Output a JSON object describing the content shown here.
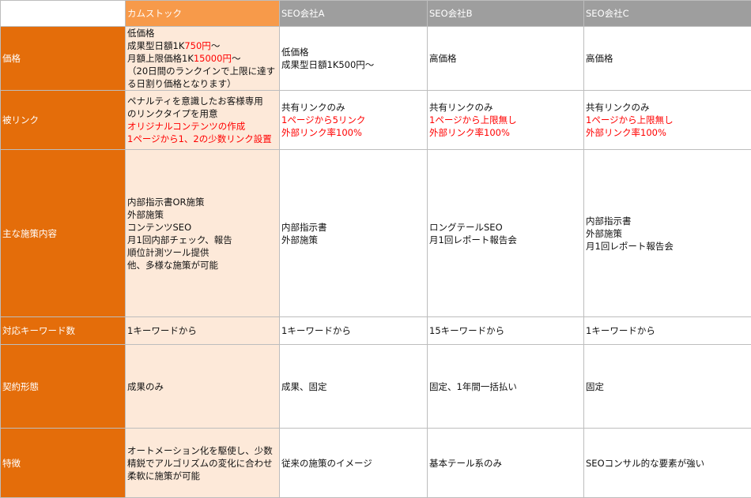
{
  "colors": {
    "header_gray": "#9e9e9e",
    "header_orange": "#f79a4a",
    "row_label": "#e46d0a",
    "highlight_column": "#fde9d9",
    "emphasis_text": "#ff0000"
  },
  "headers": [
    "",
    "カムストック",
    "SEO会社A",
    "SEO会社B",
    "SEO会社C"
  ],
  "rows": [
    {
      "label": "価格",
      "cells": [
        [
          [
            {
              "t": "低価格"
            }
          ],
          [
            {
              "t": "成果型日額1K"
            },
            {
              "t": "750円",
              "red": true
            },
            {
              "t": "～"
            }
          ],
          [
            {
              "t": "月額上限価格1K"
            },
            {
              "t": "15000円",
              "red": true
            },
            {
              "t": "～"
            }
          ],
          [
            {
              "t": "（20日間のランクインで上限に達する日割り価格となります）",
              "wrap": true
            }
          ]
        ],
        [
          [
            {
              "t": "低価格"
            }
          ],
          [
            {
              "t": "成果型日額1K500円～"
            }
          ]
        ],
        [
          [
            {
              "t": "高価格"
            }
          ]
        ],
        [
          [
            {
              "t": "高価格"
            }
          ]
        ]
      ]
    },
    {
      "label": "被リンク",
      "cells": [
        [
          [
            {
              "t": "ペナルティを意識したお客様専用"
            }
          ],
          [
            {
              "t": "のリンクタイプを用意"
            }
          ],
          [
            {
              "t": "オリジナルコンテンツの作成",
              "red": true
            }
          ],
          [
            {
              "t": "1ページから1、2の少数リンク設置",
              "red": true
            }
          ]
        ],
        [
          [
            {
              "t": "共有リンクのみ"
            }
          ],
          [
            {
              "t": "1ページから5リンク",
              "red": true
            }
          ],
          [
            {
              "t": "外部リンク率100%",
              "red": true
            }
          ]
        ],
        [
          [
            {
              "t": "共有リンクのみ"
            }
          ],
          [
            {
              "t": "1ページから上限無し",
              "red": true
            }
          ],
          [
            {
              "t": "外部リンク率100%",
              "red": true
            }
          ]
        ],
        [
          [
            {
              "t": "共有リンクのみ"
            }
          ],
          [
            {
              "t": "1ページから上限無し",
              "red": true
            }
          ],
          [
            {
              "t": "外部リンク率100%",
              "red": true
            }
          ]
        ]
      ]
    },
    {
      "label": "主な施策内容",
      "cells": [
        [
          [
            {
              "t": "内部指示書OR施策"
            }
          ],
          [
            {
              "t": "外部施策"
            }
          ],
          [
            {
              "t": "コンテンツSEO"
            }
          ],
          [
            {
              "t": "月1回内部チェック、報告"
            }
          ],
          [
            {
              "t": "順位計測ツール提供"
            }
          ],
          [
            {
              "t": "他、多様な施策が可能"
            }
          ]
        ],
        [
          [
            {
              "t": "内部指示書"
            }
          ],
          [
            {
              "t": "外部施策"
            }
          ]
        ],
        [
          [
            {
              "t": "ロングテールSEO"
            }
          ],
          [
            {
              "t": "月1回レポート報告会"
            }
          ]
        ],
        [
          [
            {
              "t": "内部指示書"
            }
          ],
          [
            {
              "t": "外部施策"
            }
          ],
          [
            {
              "t": "月1回レポート報告会"
            }
          ]
        ]
      ]
    },
    {
      "label": "対応キーワード数",
      "cells": [
        [
          [
            {
              "t": "1キーワードから"
            }
          ]
        ],
        [
          [
            {
              "t": "1キーワードから"
            }
          ]
        ],
        [
          [
            {
              "t": "15キーワードから"
            }
          ]
        ],
        [
          [
            {
              "t": "1キーワードから"
            }
          ]
        ]
      ]
    },
    {
      "label": "契約形態",
      "cells": [
        [
          [
            {
              "t": "成果のみ"
            }
          ]
        ],
        [
          [
            {
              "t": "成果、固定"
            }
          ]
        ],
        [
          [
            {
              "t": "固定、1年間一括払い"
            }
          ]
        ],
        [
          [
            {
              "t": "固定"
            }
          ]
        ]
      ]
    },
    {
      "label": "特徴",
      "cells": [
        [
          [
            {
              "t": "オートメーション化を駆使し、少数精鋭でアルゴリズムの変化に合わせ柔軟に施策が可能",
              "wrap": true
            }
          ]
        ],
        [
          [
            {
              "t": "従来の施策のイメージ"
            }
          ]
        ],
        [
          [
            {
              "t": "基本テール系のみ"
            }
          ]
        ],
        [
          [
            {
              "t": "SEOコンサル的な要素が強い"
            }
          ]
        ]
      ]
    }
  ]
}
